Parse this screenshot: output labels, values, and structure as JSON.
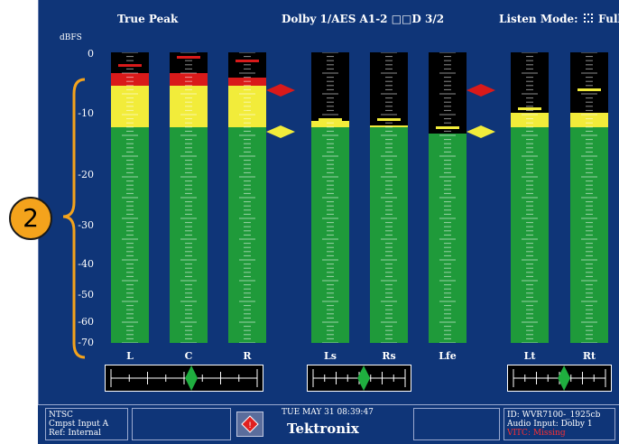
{
  "header": {
    "left": "True Peak",
    "center": "Dolby 1/AES A1-2 □□D 3/2",
    "right_label": "Listen Mode:",
    "right_value": "Full",
    "units": "dBFS"
  },
  "scale_labels": [
    "0",
    "-10",
    "-20",
    "-30",
    "-40",
    "-50",
    "-60",
    "-70"
  ],
  "callout": "2",
  "meters": [
    {
      "label": "L",
      "peak_db": -5.0,
      "hold_db": -3.0,
      "hold_color": "#d91a1a"
    },
    {
      "label": "C",
      "peak_db": -5.0,
      "hold_db": -1.0,
      "hold_color": "#d91a1a"
    },
    {
      "label": "R",
      "peak_db": -6.0,
      "hold_db": -2.0,
      "hold_color": "#d91a1a"
    },
    {
      "label": "Ls",
      "peak_db": -16.5,
      "hold_db": -16.0,
      "hold_color": "#f2ec3a"
    },
    {
      "label": "Rs",
      "peak_db": -17.5,
      "hold_db": -16.0,
      "hold_color": "#f2ec3a"
    },
    {
      "label": "Lfe",
      "peak_db": -19.5,
      "hold_db": -18.0,
      "hold_color": "#f2ec3a"
    },
    {
      "label": "Lt",
      "peak_db": -14.5,
      "hold_db": -13.5,
      "hold_color": "#f2ec3a"
    },
    {
      "label": "Rt",
      "peak_db": -14.5,
      "hold_db": -9.0,
      "hold_color": "#f2ec3a"
    }
  ],
  "meter_zones": {
    "red_above_db": -8,
    "yellow_above_db": -18
  },
  "markers": [
    {
      "level_db": -8,
      "color": "#d91a1a"
    },
    {
      "level_db": -18,
      "color": "#f2ec3a"
    }
  ],
  "phase_meters": [
    {
      "position": 0.55
    },
    {
      "position": 0.55
    },
    {
      "position": 0.55
    }
  ],
  "status": {
    "left_line1": "NTSC",
    "left_line2": "Cmpst Input A",
    "left_line3": "Ref: Internal",
    "datetime": "TUE MAY 31 08:39:47",
    "brand": "Tektronix",
    "right_line1": "ID: WVR7100-_1925cb",
    "right_line2": "Audio Input: Dolby 1",
    "right_line3": "VITC: Missing"
  },
  "colors": {
    "background": "#0f3578",
    "meter_green": "#1f9a3a",
    "meter_yellow": "#f2ec3a",
    "meter_red": "#d91a1a",
    "callout": "#f4a31c",
    "alert_text": "#ff3030"
  }
}
